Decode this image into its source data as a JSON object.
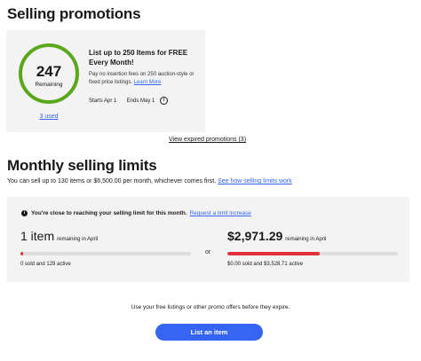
{
  "promotions": {
    "heading": "Selling promotions",
    "remaining_count": "247",
    "remaining_label": "Remaining",
    "ring_fraction_remaining": 0.988,
    "used_link": "3 used",
    "title": "List up to 250 Items for FREE Every Month!",
    "description": "Pay no insertion fees on 250 auction-style or fixed price listings.",
    "learn_more": "Learn More",
    "starts": "Starts Apr 1",
    "ends": "Ends May 1",
    "view_expired": "View expired promotions (3)"
  },
  "limits": {
    "heading": "Monthly selling limits",
    "summary": "You can sell up to 130 items or $6,500.00 per month, whichever comes first.",
    "how_link": "See how selling limits work",
    "alert_text": "You're close to reaching your selling limit for this month.",
    "request_link": "Request a limit increase",
    "items_value": "1 item",
    "items_suffix": "remaining in April",
    "items_fraction_used": 0.01,
    "items_detail": "0 sold and 129 active",
    "or_label": "or",
    "amount_value": "$2,971.29",
    "amount_suffix": "remaining in April",
    "amount_fraction_used": 0.54,
    "amount_detail": "$0.00 sold and $3,528.71 active"
  },
  "footer": {
    "note": "Use your free listings or other promo offers before they expire.",
    "button_label": "List an item"
  },
  "colors": {
    "accent": "#3665f3",
    "ring_green": "#5ba71b",
    "bar_red": "#e0323c"
  }
}
